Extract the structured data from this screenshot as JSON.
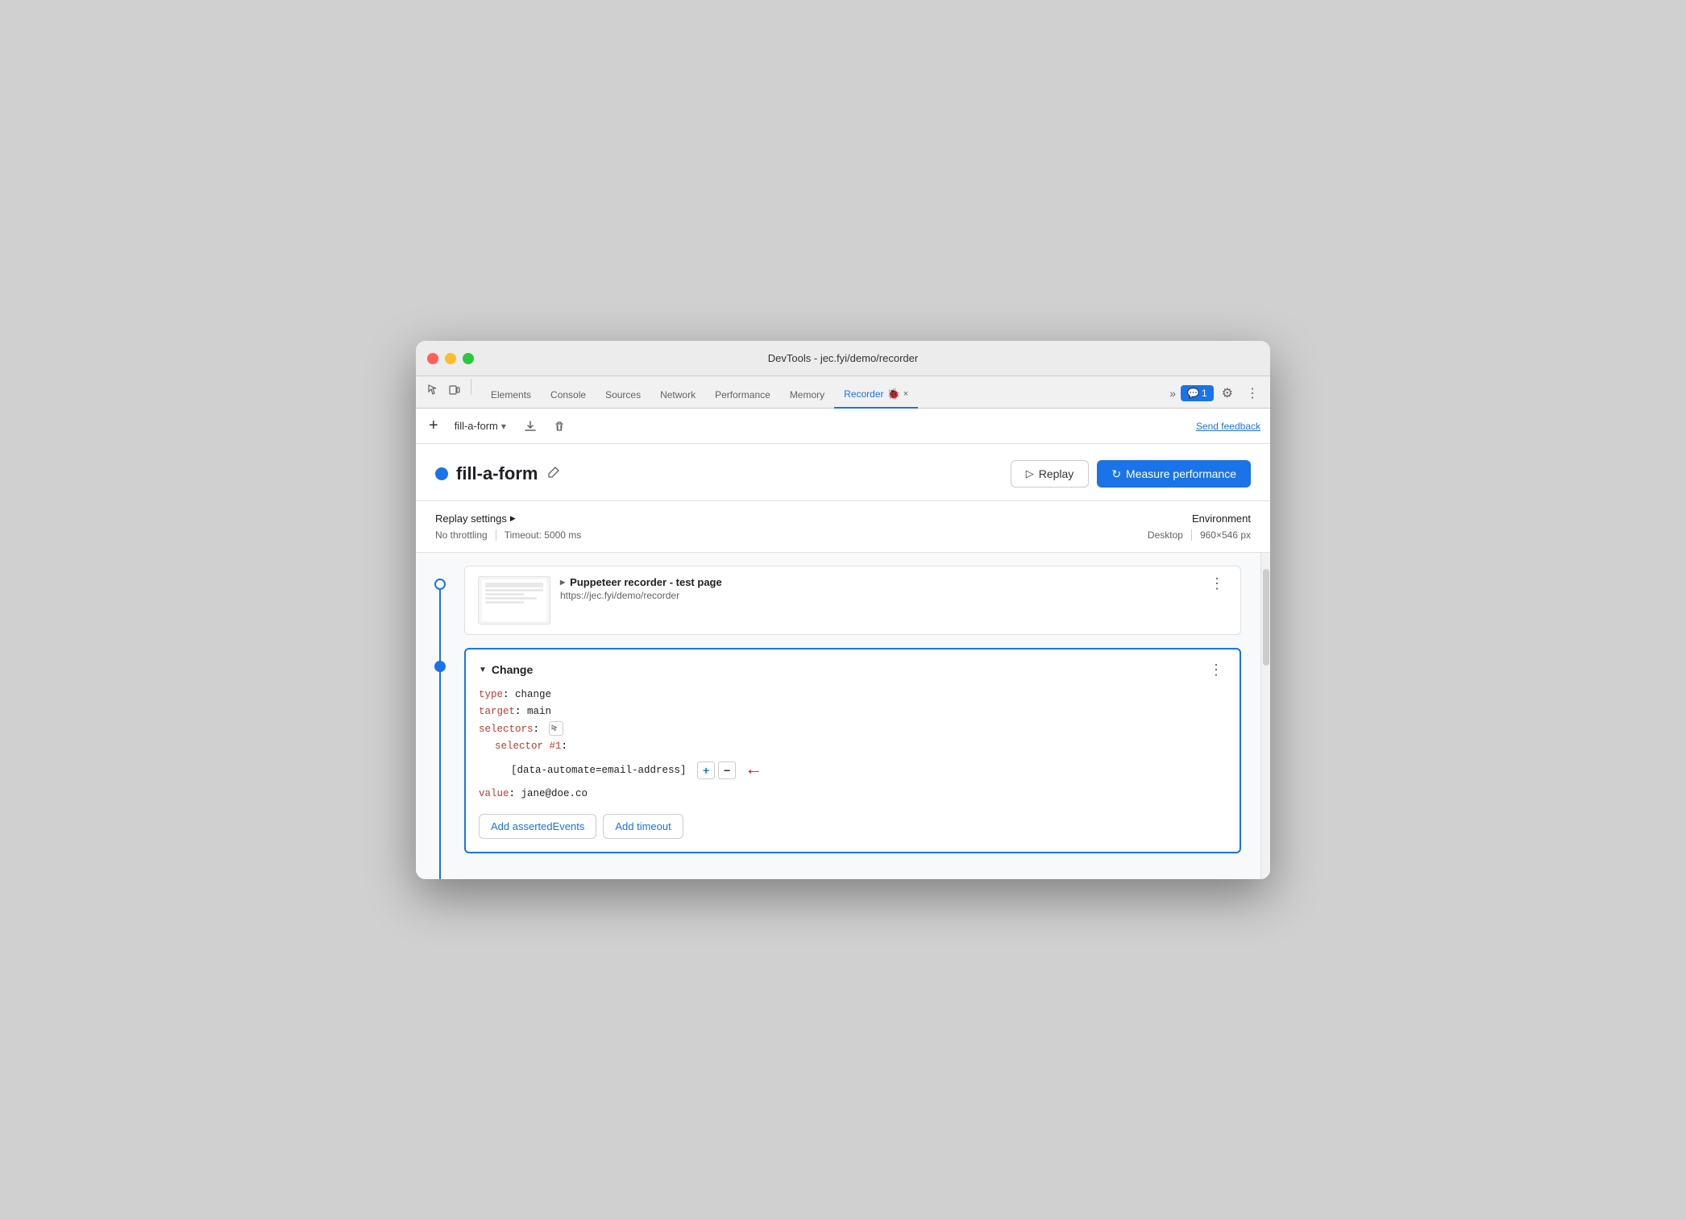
{
  "window": {
    "title": "DevTools - jec.fyi/demo/recorder"
  },
  "tabs": {
    "items": [
      {
        "label": "Elements",
        "active": false
      },
      {
        "label": "Console",
        "active": false
      },
      {
        "label": "Sources",
        "active": false
      },
      {
        "label": "Network",
        "active": false
      },
      {
        "label": "Performance",
        "active": false
      },
      {
        "label": "Memory",
        "active": false
      },
      {
        "label": "Recorder",
        "active": true
      }
    ],
    "recorder_close": "×",
    "more_tabs": "»",
    "chat_label": "1",
    "settings_icon": "⚙",
    "more_icon": "⋮"
  },
  "toolbar": {
    "add_icon": "+",
    "recording_name": "fill-a-form",
    "dropdown_arrow": "▾",
    "download_icon": "⬇",
    "delete_icon": "🗑",
    "feedback_label": "Send feedback"
  },
  "header": {
    "dot_color": "#1a73e8",
    "title": "fill-a-form",
    "edit_icon": "✏",
    "replay_label": "Replay",
    "measure_label": "Measure performance",
    "play_icon": "▷",
    "measure_icon": "↻"
  },
  "settings": {
    "replay_settings_label": "Replay settings",
    "expand_icon": "▶",
    "throttle_label": "No throttling",
    "timeout_label": "Timeout: 5000 ms",
    "environment_label": "Environment",
    "desktop_label": "Desktop",
    "dimensions_label": "960×546 px"
  },
  "steps": {
    "navigate": {
      "title": "Puppeteer recorder - test page",
      "url": "https://jec.fyi/demo/recorder"
    },
    "change": {
      "title": "Change",
      "type_key": "type",
      "type_val": "change",
      "target_key": "target",
      "target_val": "main",
      "selectors_key": "selectors",
      "selector_num_key": "selector #1",
      "selector_val": "[data-automate=email-address]",
      "value_key": "value",
      "value_val": "jane@doe.co",
      "add_events_label": "Add assertedEvents",
      "add_timeout_label": "Add timeout"
    }
  }
}
